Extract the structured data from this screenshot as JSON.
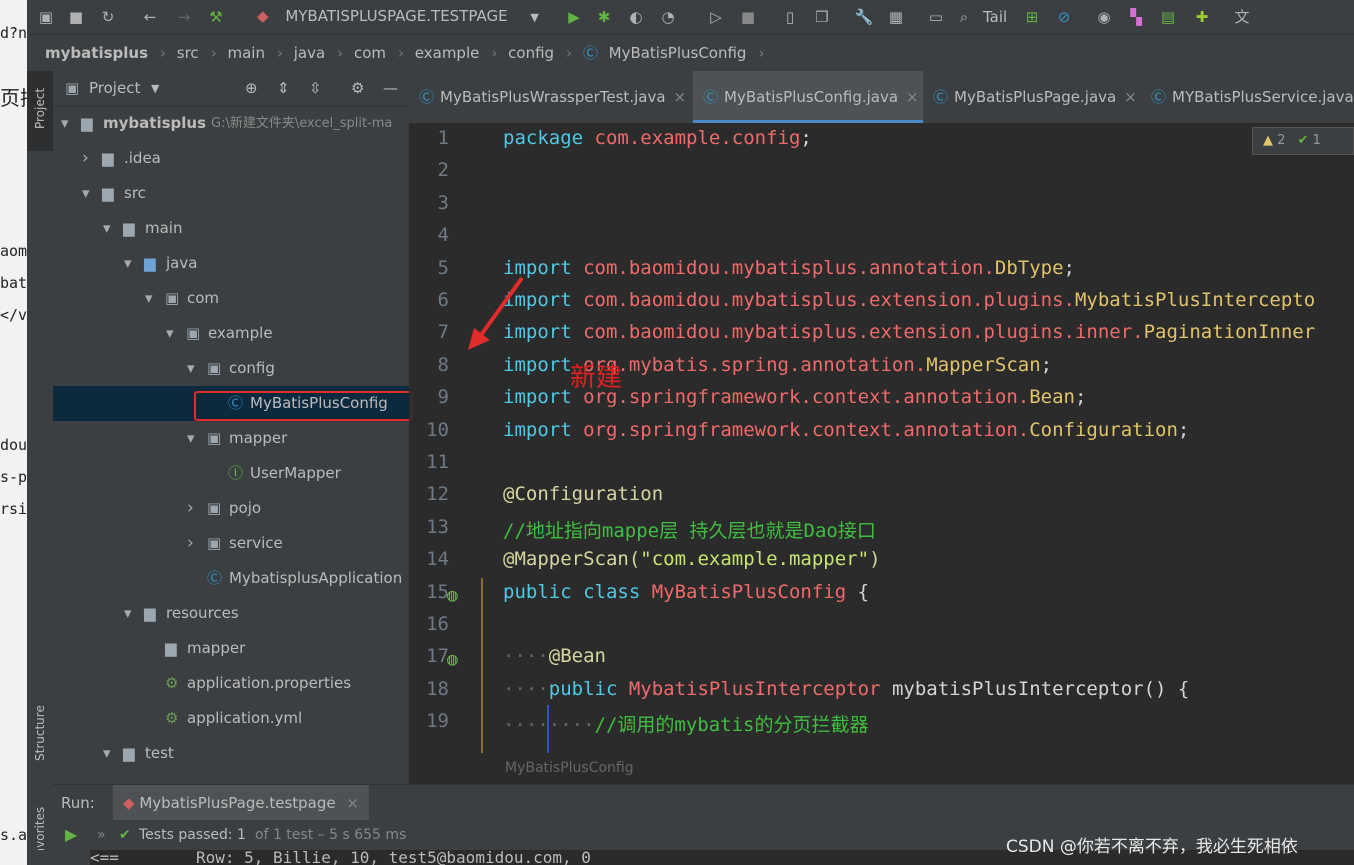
{
  "toolbar": {
    "run_config": "MYBATISPLUSPAGE.TESTPAGE",
    "tail_label": "Tail"
  },
  "breadcrumb": [
    "mybatisplus",
    "src",
    "main",
    "java",
    "com",
    "example",
    "config",
    "MyBatisPlusConfig"
  ],
  "left_strip": {
    "project": "Project",
    "structure": "Structure",
    "favorites": "Favorites"
  },
  "project_panel": {
    "title": "Project",
    "tree": [
      {
        "label": "mybatisplus",
        "path": "G:\\新建文件夹\\excel_split-ma",
        "indent": 0,
        "expanded": true,
        "type": "module"
      },
      {
        "label": ".idea",
        "indent": 1,
        "expanded": false,
        "type": "folder"
      },
      {
        "label": "src",
        "indent": 1,
        "expanded": true,
        "type": "folder"
      },
      {
        "label": "main",
        "indent": 2,
        "expanded": true,
        "type": "folder"
      },
      {
        "label": "java",
        "indent": 3,
        "expanded": true,
        "type": "folder-blue"
      },
      {
        "label": "com",
        "indent": 4,
        "expanded": true,
        "type": "package"
      },
      {
        "label": "example",
        "indent": 5,
        "expanded": true,
        "type": "package"
      },
      {
        "label": "config",
        "indent": 6,
        "expanded": true,
        "type": "package"
      },
      {
        "label": "MyBatisPlusConfig",
        "indent": 7,
        "type": "class",
        "selected": true
      },
      {
        "label": "mapper",
        "indent": 6,
        "expanded": true,
        "type": "package"
      },
      {
        "label": "UserMapper",
        "indent": 7,
        "type": "interface"
      },
      {
        "label": "pojo",
        "indent": 6,
        "expanded": false,
        "type": "package"
      },
      {
        "label": "service",
        "indent": 6,
        "expanded": false,
        "type": "package"
      },
      {
        "label": "MybatisplusApplication",
        "indent": 6,
        "type": "spring-class"
      },
      {
        "label": "resources",
        "indent": 3,
        "expanded": true,
        "type": "folder"
      },
      {
        "label": "mapper",
        "indent": 4,
        "type": "folder"
      },
      {
        "label": "application.properties",
        "indent": 4,
        "type": "config-file"
      },
      {
        "label": "application.yml",
        "indent": 4,
        "type": "config-file"
      },
      {
        "label": "test",
        "indent": 2,
        "expanded": true,
        "type": "folder"
      }
    ]
  },
  "tabs": [
    {
      "label": "MyBatisPlusWrassperTest.java",
      "active": false
    },
    {
      "label": "MyBatisPlusConfig.java",
      "active": true
    },
    {
      "label": "MyBatisPlusPage.java",
      "active": false
    },
    {
      "label": "MYBatisPlusService.java",
      "active": false
    }
  ],
  "inspection": {
    "warnings": "2",
    "ok": "1"
  },
  "code_lines": [
    {
      "n": "1",
      "t": [
        [
          "kw",
          "package "
        ],
        [
          "pk",
          "com.example.config"
        ],
        [
          "",
          ";"
        ]
      ]
    },
    {
      "n": "2",
      "t": []
    },
    {
      "n": "3",
      "t": []
    },
    {
      "n": "4",
      "t": []
    },
    {
      "n": "5",
      "t": [
        [
          "kw",
          "import "
        ],
        [
          "pk",
          "com.baomidou.mybatisplus.annotation."
        ],
        [
          "cl",
          "DbType"
        ],
        [
          "",
          ";"
        ]
      ]
    },
    {
      "n": "6",
      "t": [
        [
          "kw",
          "import "
        ],
        [
          "pk",
          "com.baomidou.mybatisplus.extension.plugins."
        ],
        [
          "cl",
          "MybatisPlusIntercepto"
        ]
      ]
    },
    {
      "n": "7",
      "t": [
        [
          "kw",
          "import "
        ],
        [
          "pk",
          "com.baomidou.mybatisplus.extension.plugins.inner."
        ],
        [
          "cl",
          "PaginationInner"
        ]
      ]
    },
    {
      "n": "8",
      "t": [
        [
          "kw",
          "import "
        ],
        [
          "pk",
          "org.mybatis.spring.annotation."
        ],
        [
          "cl",
          "MapperScan"
        ],
        [
          "",
          ";"
        ]
      ]
    },
    {
      "n": "9",
      "t": [
        [
          "kw",
          "import "
        ],
        [
          "pk",
          "org.springframework.context.annotation."
        ],
        [
          "cl",
          "Bean"
        ],
        [
          "",
          ";"
        ]
      ]
    },
    {
      "n": "10",
      "t": [
        [
          "kw",
          "import "
        ],
        [
          "pk",
          "org.springframework.context.annotation."
        ],
        [
          "cl",
          "Configuration"
        ],
        [
          "",
          ";"
        ]
      ]
    },
    {
      "n": "11",
      "t": []
    },
    {
      "n": "12",
      "t": [
        [
          "an",
          "@Configuration"
        ]
      ]
    },
    {
      "n": "13",
      "t": [
        [
          "cm",
          "//地址指向mappe层 持久层也就是Dao接口"
        ]
      ]
    },
    {
      "n": "14",
      "t": [
        [
          "an",
          "@MapperScan("
        ],
        [
          "str",
          "\"com.example.mapper\""
        ],
        [
          "an",
          ")"
        ]
      ]
    },
    {
      "n": "15",
      "t": [
        [
          "kw",
          "public class "
        ],
        [
          "pk",
          "MyBatisPlusConfig"
        ],
        [
          "",
          " {"
        ]
      ]
    },
    {
      "n": "16",
      "t": []
    },
    {
      "n": "17",
      "t": [
        [
          "dot",
          "····"
        ],
        [
          "an",
          "@Bean"
        ]
      ]
    },
    {
      "n": "18",
      "t": [
        [
          "dot",
          "····"
        ],
        [
          "kw",
          "public "
        ],
        [
          "pk",
          "MybatisPlusInterceptor "
        ],
        [
          "",
          "mybatisPlusInterceptor() {"
        ]
      ]
    },
    {
      "n": "19",
      "t": [
        [
          "dot",
          "········"
        ],
        [
          "cm",
          "//调用的mybatis的分页拦截器"
        ]
      ]
    }
  ],
  "annotation_text": "新建",
  "editor_footer": "MyBatisPlusConfig",
  "run": {
    "label": "Run:",
    "tab": "MybatisPlusPage.testpage",
    "status_passed": "Tests passed: 1",
    "status_rest": "of 1 test – 5 s 655 ms",
    "console": "<==        Row: 5, Billie, 10, test5@baomidou.com, 0"
  },
  "watermark": "CSDN @你若不离不弃，我必生死相依",
  "bg_fragments": [
    "d?n",
    "页插",
    "aom",
    "bat",
    "</v",
    "dou",
    "s-p",
    "rsi",
    "s.a"
  ]
}
